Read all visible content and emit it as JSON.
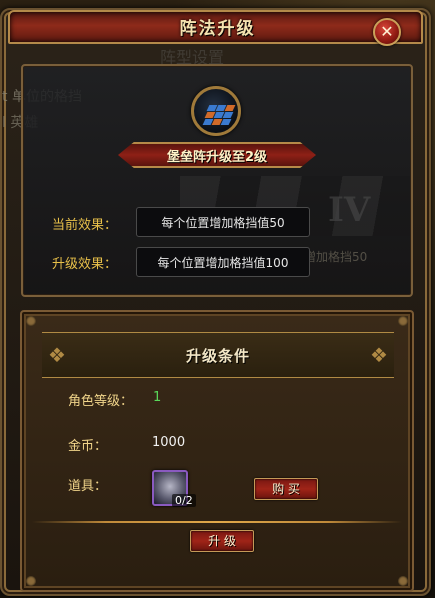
{
  "dialog": {
    "title": "阵法升级",
    "close_glyph": "✕",
    "faint_subtitle": "阵型设置"
  },
  "background_ghost": {
    "line1": "t 单位的格挡",
    "line2": "l 英雄",
    "line3": "增加格挡50",
    "roman": "IV"
  },
  "upgrade": {
    "icon": "formation-grid-icon",
    "banner": "堡垒阵升级至2级",
    "current_label": "当前效果：",
    "current_value": "每个位置增加格挡值50",
    "next_label": "升级效果：",
    "next_value": "每个位置增加格挡值100"
  },
  "conditions": {
    "header": "升级条件",
    "level_label": "角色等级：",
    "level_value": "1",
    "gold_label": "金币：",
    "gold_value": "1000",
    "item_label": "道具：",
    "item_icon": "spirit-orb-icon",
    "item_count": "0/2",
    "buy_label": "购 买",
    "upgrade_label": "升 级"
  },
  "colors": {
    "accent_red": "#8e2a1a",
    "gold_border": "#b48a4a",
    "label_yellow": "#e8c04a",
    "level_green": "#5ad85a"
  }
}
